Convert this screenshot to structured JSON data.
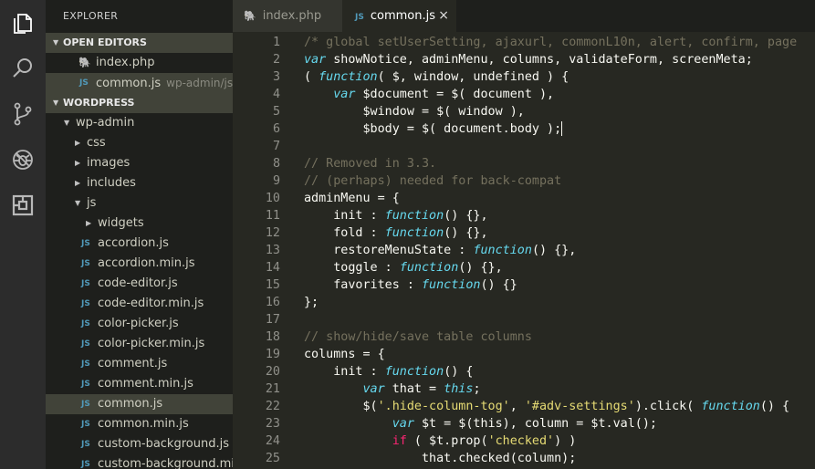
{
  "activity_bar": {
    "icons": [
      "files-icon",
      "search-icon",
      "source-control-icon",
      "debug-icon",
      "extensions-icon"
    ]
  },
  "explorer": {
    "title": "EXPLORER",
    "open_editors": {
      "header": "OPEN EDITORS",
      "items": [
        {
          "icon": "php-file-icon",
          "glyph": "🐘",
          "name": "index.php",
          "path": ""
        },
        {
          "icon": "js-file-icon",
          "glyph": "JS",
          "name": "common.js",
          "path": "wp-admin/js"
        }
      ]
    },
    "workspace": {
      "header": "WORDPRESS",
      "tree": [
        {
          "type": "folder",
          "expanded": true,
          "name": "wp-admin"
        },
        {
          "type": "folder",
          "expanded": false,
          "name": "css"
        },
        {
          "type": "folder",
          "expanded": false,
          "name": "images"
        },
        {
          "type": "folder",
          "expanded": false,
          "name": "includes"
        },
        {
          "type": "folder",
          "expanded": true,
          "name": "js"
        },
        {
          "type": "folder",
          "expanded": false,
          "name": "widgets"
        },
        {
          "type": "file",
          "name": "accordion.js"
        },
        {
          "type": "file",
          "name": "accordion.min.js"
        },
        {
          "type": "file",
          "name": "code-editor.js"
        },
        {
          "type": "file",
          "name": "code-editor.min.js"
        },
        {
          "type": "file",
          "name": "color-picker.js"
        },
        {
          "type": "file",
          "name": "color-picker.min.js"
        },
        {
          "type": "file",
          "name": "comment.js"
        },
        {
          "type": "file",
          "name": "comment.min.js"
        },
        {
          "type": "file",
          "name": "common.js",
          "selected": true
        },
        {
          "type": "file",
          "name": "common.min.js"
        },
        {
          "type": "file",
          "name": "custom-background.js"
        },
        {
          "type": "file",
          "name": "custom-background.mi..."
        }
      ]
    }
  },
  "tabs": [
    {
      "icon": "php-file-icon",
      "glyph": "🐘",
      "label": "index.php",
      "active": false
    },
    {
      "icon": "js-file-icon",
      "glyph": "JS",
      "label": "common.js",
      "active": true,
      "close": "×"
    }
  ],
  "editor": {
    "lines": [
      {
        "n": "1",
        "tokens": [
          [
            "c",
            "/* global setUserSetting, ajaxurl, commonL10n, alert, confirm, page"
          ]
        ]
      },
      {
        "n": "2",
        "tokens": [
          [
            "k",
            "var"
          ],
          [
            "",
            " showNotice, adminMenu, columns, validateForm, screenMeta;"
          ]
        ]
      },
      {
        "n": "3",
        "tokens": [
          [
            "",
            "( "
          ],
          [
            "k",
            "function"
          ],
          [
            "",
            "( $, window, undefined ) {"
          ]
        ]
      },
      {
        "n": "4",
        "tokens": [
          [
            "",
            "    "
          ],
          [
            "k",
            "var"
          ],
          [
            "",
            " $document = $( document ),"
          ]
        ]
      },
      {
        "n": "5",
        "tokens": [
          [
            "",
            "        $window = $( window ),"
          ]
        ]
      },
      {
        "n": "6",
        "tokens": [
          [
            "",
            "        $body = $( document.body );"
          ]
        ],
        "cursor": true
      },
      {
        "n": "7",
        "tokens": []
      },
      {
        "n": "8",
        "tokens": [
          [
            "c",
            "// Removed in 3.3."
          ]
        ]
      },
      {
        "n": "9",
        "tokens": [
          [
            "c",
            "// (perhaps) needed for back-compat"
          ]
        ]
      },
      {
        "n": "10",
        "tokens": [
          [
            "",
            "adminMenu = {"
          ]
        ]
      },
      {
        "n": "11",
        "tokens": [
          [
            "",
            "    init : "
          ],
          [
            "k",
            "function"
          ],
          [
            "",
            "() {},"
          ]
        ]
      },
      {
        "n": "12",
        "tokens": [
          [
            "",
            "    fold : "
          ],
          [
            "k",
            "function"
          ],
          [
            "",
            "() {},"
          ]
        ]
      },
      {
        "n": "13",
        "tokens": [
          [
            "",
            "    restoreMenuState : "
          ],
          [
            "k",
            "function"
          ],
          [
            "",
            "() {},"
          ]
        ]
      },
      {
        "n": "14",
        "tokens": [
          [
            "",
            "    toggle : "
          ],
          [
            "k",
            "function"
          ],
          [
            "",
            "() {},"
          ]
        ]
      },
      {
        "n": "15",
        "tokens": [
          [
            "",
            "    favorites : "
          ],
          [
            "k",
            "function"
          ],
          [
            "",
            "() {}"
          ]
        ]
      },
      {
        "n": "16",
        "tokens": [
          [
            "",
            "};"
          ]
        ]
      },
      {
        "n": "17",
        "tokens": []
      },
      {
        "n": "18",
        "tokens": [
          [
            "c",
            "// show/hide/save table columns"
          ]
        ]
      },
      {
        "n": "19",
        "tokens": [
          [
            "",
            "columns = {"
          ]
        ]
      },
      {
        "n": "20",
        "tokens": [
          [
            "",
            "    init : "
          ],
          [
            "k",
            "function"
          ],
          [
            "",
            "() {"
          ]
        ]
      },
      {
        "n": "21",
        "tokens": [
          [
            "",
            "        "
          ],
          [
            "k",
            "var"
          ],
          [
            "",
            " that = "
          ],
          [
            "k",
            "this"
          ],
          [
            "",
            ";"
          ]
        ]
      },
      {
        "n": "22",
        "tokens": [
          [
            "",
            "        $("
          ],
          [
            "s",
            "'.hide-column-tog'"
          ],
          [
            "",
            ", "
          ],
          [
            "s",
            "'#adv-settings'"
          ],
          [
            "",
            ").click( "
          ],
          [
            "k",
            "function"
          ],
          [
            "",
            "() {"
          ]
        ]
      },
      {
        "n": "23",
        "tokens": [
          [
            "",
            "            "
          ],
          [
            "k",
            "var"
          ],
          [
            "",
            " $t = $(this), column = $t.val();"
          ]
        ]
      },
      {
        "n": "24",
        "tokens": [
          [
            "",
            "            "
          ],
          [
            "k2",
            "if"
          ],
          [
            "",
            " ( $t.prop("
          ],
          [
            "s",
            "'checked'"
          ],
          [
            "",
            ") )"
          ]
        ]
      },
      {
        "n": "25",
        "tokens": [
          [
            "",
            "                that.checked(column);"
          ]
        ]
      }
    ]
  }
}
